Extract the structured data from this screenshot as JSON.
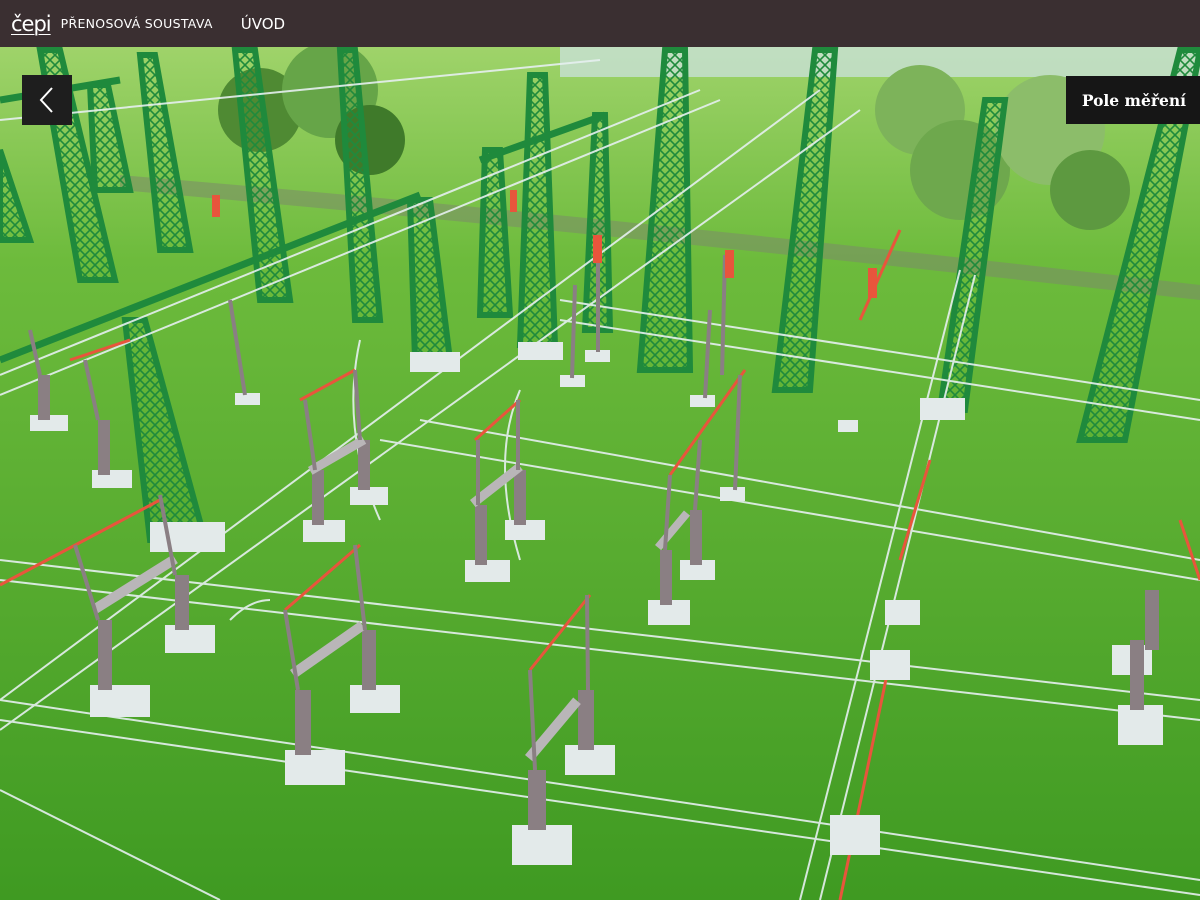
{
  "header": {
    "logo_text": "čepi",
    "app_title": "PŘENOSOVÁ SOUSTAVA",
    "nav_home": "ÚVOD"
  },
  "navigation": {
    "back_icon": "chevron-left-icon",
    "field_button": "Pole měření"
  },
  "scene": {
    "description_icon": "3d-substation-view",
    "colors": {
      "grass": "#4fa62c",
      "tower": "#1f8a3c",
      "wire": "#e6f0f0",
      "wire_hot": "#e8553c",
      "concrete": "#e3eaea",
      "steel": "#8a7f83"
    }
  }
}
